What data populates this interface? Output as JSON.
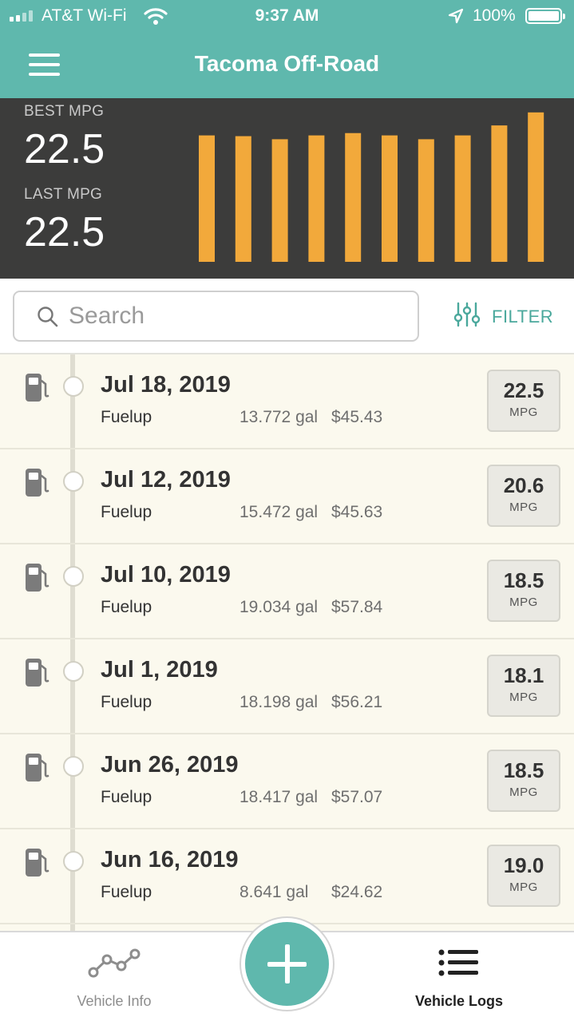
{
  "status_bar": {
    "carrier": "AT&T Wi-Fi",
    "time": "9:37 AM",
    "battery": "100%"
  },
  "nav": {
    "title": "Tacoma Off-Road",
    "menu_icon": "hamburger-menu-icon"
  },
  "stats": {
    "best_label": "BEST MPG",
    "best_value": "22.5",
    "last_label": "LAST MPG",
    "last_value": "22.5"
  },
  "chart_data": {
    "type": "bar",
    "values": [
      16.5,
      16.4,
      16.0,
      16.5,
      16.8,
      16.5,
      16.0,
      16.5,
      17.8,
      19.5
    ],
    "color": "#f2a93b"
  },
  "search": {
    "placeholder": "Search",
    "filter_label": "FILTER"
  },
  "entries": [
    {
      "date": "Jul 18, 2019",
      "type": "Fuelup",
      "gallons": "13.772 gal",
      "cost": "$45.43",
      "mpg": "22.5",
      "unit": "MPG"
    },
    {
      "date": "Jul 12, 2019",
      "type": "Fuelup",
      "gallons": "15.472 gal",
      "cost": "$45.63",
      "mpg": "20.6",
      "unit": "MPG"
    },
    {
      "date": "Jul 10, 2019",
      "type": "Fuelup",
      "gallons": "19.034 gal",
      "cost": "$57.84",
      "mpg": "18.5",
      "unit": "MPG"
    },
    {
      "date": "Jul 1, 2019",
      "type": "Fuelup",
      "gallons": "18.198 gal",
      "cost": "$56.21",
      "mpg": "18.1",
      "unit": "MPG"
    },
    {
      "date": "Jun 26, 2019",
      "type": "Fuelup",
      "gallons": "18.417 gal",
      "cost": "$57.07",
      "mpg": "18.5",
      "unit": "MPG"
    },
    {
      "date": "Jun 16, 2019",
      "type": "Fuelup",
      "gallons": "8.641 gal",
      "cost": "$24.62",
      "mpg": "19.0",
      "unit": "MPG"
    }
  ],
  "tabs": {
    "vehicle_info": "Vehicle Info",
    "vehicle_logs": "Vehicle Logs",
    "add_icon": "plus-icon"
  },
  "colors": {
    "brand_teal": "#5fb8ad",
    "bar_orange": "#f2a93b",
    "header_dark": "#3c3c3b",
    "list_bg": "#fbf9ee"
  }
}
